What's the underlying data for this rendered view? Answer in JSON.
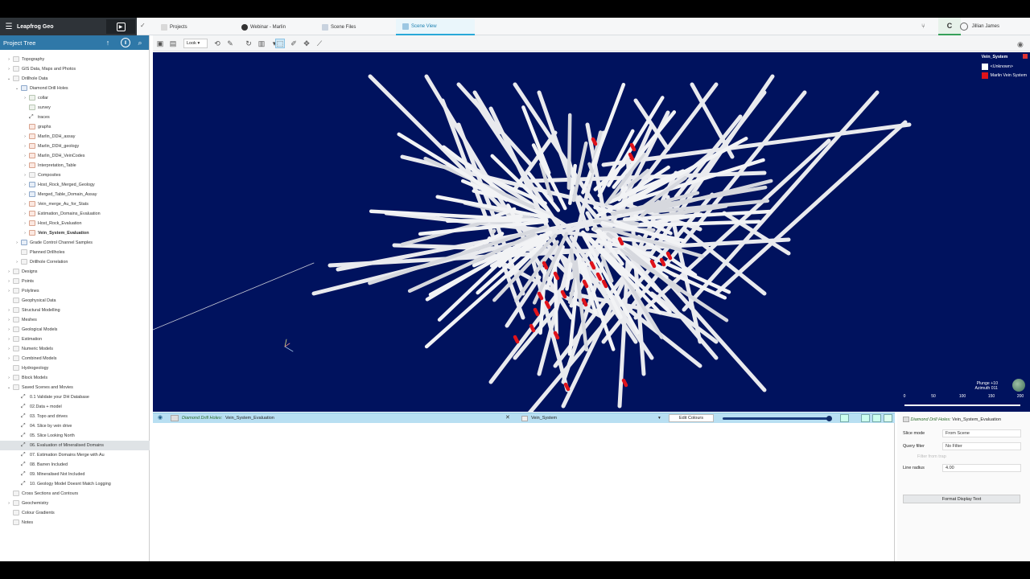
{
  "app": {
    "name": "Leapfrog Geo",
    "user": "Jillian James",
    "tabs": [
      {
        "label": "Projects"
      },
      {
        "label": "Webinar - Marlin"
      },
      {
        "label": "Scene Files"
      },
      {
        "label": "Scene View"
      }
    ]
  },
  "left_panel": {
    "title": "Project Tree",
    "items": [
      {
        "label": "Topography"
      },
      {
        "label": "GIS Data, Maps and Photos"
      },
      {
        "label": "Drillhole Data"
      },
      {
        "label": "Diamond Drill Holes"
      },
      {
        "label": "collar"
      },
      {
        "label": "survey"
      },
      {
        "label": "traces"
      },
      {
        "label": "graphs"
      },
      {
        "label": "Marlin_DDH_assay"
      },
      {
        "label": "Marlin_DDH_geology"
      },
      {
        "label": "Marlin_DDH_VeinCodes"
      },
      {
        "label": "Interpretation_Table"
      },
      {
        "label": "Composites"
      },
      {
        "label": "Host_Rock_Merged_Geology"
      },
      {
        "label": "Merged_Table_Domain_Assay"
      },
      {
        "label": "Vein_merge_Au_for_Stats"
      },
      {
        "label": "Estimation_Domains_Evaluation"
      },
      {
        "label": "Host_Rock_Evaluation"
      },
      {
        "label": "Vein_System_Evaluation"
      },
      {
        "label": "Grade Control Channel Samples"
      },
      {
        "label": "Planned Drillholes"
      },
      {
        "label": "Drillhole Correlation"
      },
      {
        "label": "Designs"
      },
      {
        "label": "Points"
      },
      {
        "label": "Polylines"
      },
      {
        "label": "Geophysical Data"
      },
      {
        "label": "Structural Modelling"
      },
      {
        "label": "Meshes"
      },
      {
        "label": "Geological Models"
      },
      {
        "label": "Estimation"
      },
      {
        "label": "Numeric Models"
      },
      {
        "label": "Combined Models"
      },
      {
        "label": "Hydrogeology"
      },
      {
        "label": "Block Models"
      },
      {
        "label": "Saved Scenes and Movies"
      },
      {
        "label": "0.1 Validate your DH Database"
      },
      {
        "label": "02.Data + model"
      },
      {
        "label": "03. Topo and drives"
      },
      {
        "label": "04. Slice by vein drive"
      },
      {
        "label": "05. Slice Looking North"
      },
      {
        "label": "06. Evaluation of Mineralised Domains"
      },
      {
        "label": "07. Estimation Domains Merge with Au"
      },
      {
        "label": "08. Barren Included"
      },
      {
        "label": "09. Mineralised Not Included"
      },
      {
        "label": "10. Geology Model Doesnt Match Logging"
      },
      {
        "label": "Cross Sections and Contours"
      },
      {
        "label": "Geochemistry"
      },
      {
        "label": "Colour Gradients"
      },
      {
        "label": "Notes"
      }
    ]
  },
  "toolbar": {
    "look_label": "Look"
  },
  "scene": {
    "legend": {
      "title": "Vein_System",
      "items": [
        {
          "label": "<Unknown>",
          "color": "#ffffff"
        },
        {
          "label": "Marlin Vein System",
          "color": "#e0131b"
        }
      ]
    },
    "plunge": "Plunge +10",
    "azimuth": "Azimuth 011",
    "scale_ticks": [
      "0",
      "50",
      "100",
      "150",
      "200"
    ],
    "background_color": "#00125e"
  },
  "shape_list": {
    "object_prefix": "Diamond Drill Holes:",
    "object_name": "Vein_System_Evaluation",
    "column": "Vein_System",
    "edit_colours_label": "Edit Colours"
  },
  "properties": {
    "title_prefix": "Diamond Drill Holes:",
    "title_name": "Vein_System_Evaluation",
    "slice_mode_label": "Slice mode",
    "slice_mode_value": "From Scene",
    "query_filter_label": "Query filter",
    "query_filter_value": "No Filter",
    "filter_note": "Filter from trap",
    "line_radius_label": "Line radius",
    "line_radius_value": "4.00",
    "format_button": "Format Display Text"
  }
}
